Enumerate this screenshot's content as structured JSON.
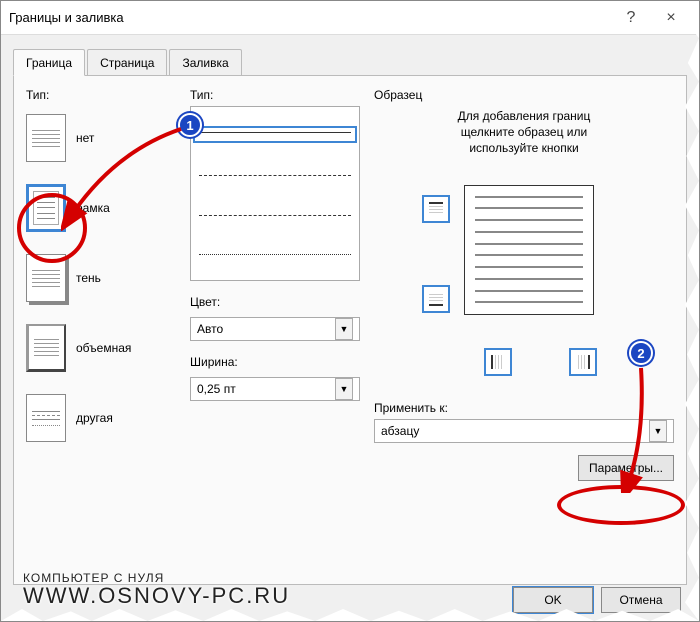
{
  "title": "Границы и заливка",
  "help_label": "?",
  "close_label": "×",
  "tabs": {
    "border": "Граница",
    "page": "Страница",
    "fill": "Заливка"
  },
  "type": {
    "label": "Тип:",
    "none": "нет",
    "box": "рамка",
    "shadow": "тень",
    "threeD": "объемная",
    "custom": "другая"
  },
  "style": {
    "label": "Тип:",
    "color_label": "Цвет:",
    "color_value": "Авто",
    "width_label": "Ширина:",
    "width_value": "0,25 пт"
  },
  "sample": {
    "label": "Образец",
    "hint_line1": "Для добавления границ",
    "hint_line2": "щелкните образец или",
    "hint_line3": "используйте кнопки",
    "apply_label": "Применить к:",
    "apply_value": "абзацу",
    "options_btn": "Параметры..."
  },
  "footer": {
    "ok": "OK",
    "cancel": "Отмена"
  },
  "annotations": {
    "n1": "1",
    "n2": "2"
  },
  "watermark": {
    "line1": "КОМПЬЮТЕР С НУЛЯ",
    "line2": "WWW.OSNOVY-PC.RU"
  }
}
